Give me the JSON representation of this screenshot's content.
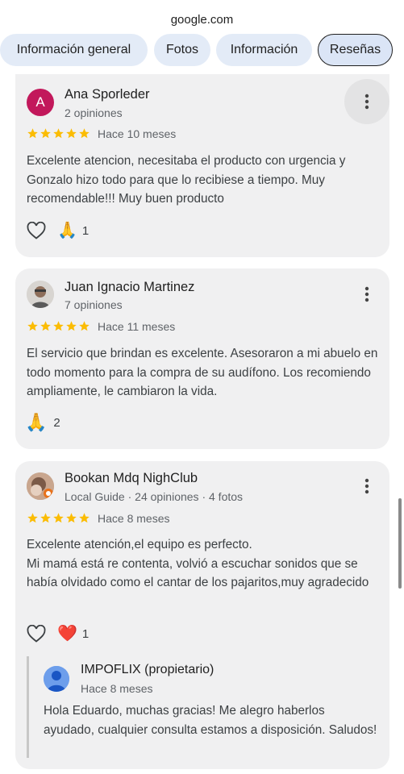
{
  "browser": {
    "url": "google.com"
  },
  "tabs": [
    {
      "label": "Información general",
      "active": false
    },
    {
      "label": "Fotos",
      "active": false
    },
    {
      "label": "Información",
      "active": false
    },
    {
      "label": "Reseñas",
      "active": true
    }
  ],
  "reviews": [
    {
      "author": "Ana Sporleder",
      "avatar_letter": "A",
      "meta": "2 opiniones",
      "rating": 5,
      "when": "Hace 10 meses",
      "text": "Excelente atencion, necesitaba el producto con urgencia y Gonzalo hizo todo para que lo recibiese a tiempo. Muy recomendable!!! Muy buen producto",
      "reactions": [
        {
          "icon": "thank-you-emoji",
          "count": "1"
        }
      ]
    },
    {
      "author": "Juan Ignacio Martinez",
      "meta": "7 opiniones",
      "rating": 5,
      "when": "Hace 11 meses",
      "text": "El servicio que brindan es excelente. Asesoraron a mi abuelo en todo momento para la compra de su audífono. Los recomiendo ampliamente, le cambiaron la vida.",
      "reactions": [
        {
          "icon": "thank-you-emoji",
          "count": "2"
        }
      ]
    },
    {
      "author": "Bookan Mdq NighClub",
      "meta": "Local Guide · 24 opiniones · 4 fotos",
      "rating": 5,
      "when": "Hace 8 meses",
      "text_lines": [
        "Excelente atención,el equipo es perfecto.",
        "Mi mamá está re contenta, volvió a escuchar sonidos que se había olvidado como el cantar de los pajaritos,muy agradecido"
      ],
      "reactions": [
        {
          "icon": "red-heart-emoji",
          "count": "1"
        }
      ],
      "owner_reply": {
        "name": "IMPOFLIX (propietario)",
        "when": "Hace 8 meses",
        "text": "Hola Eduardo, muchas gracias! Me alegro haberlos ayudado, cualquier consulta estamos a disposición. Saludos!"
      }
    }
  ],
  "colors": {
    "star": "#fbbc04",
    "card_bg": "#f0f0f1",
    "tab_bg": "#e3ebf7",
    "avatar_a": "#c2185b",
    "owner_avatar": "#6d9eeb"
  }
}
